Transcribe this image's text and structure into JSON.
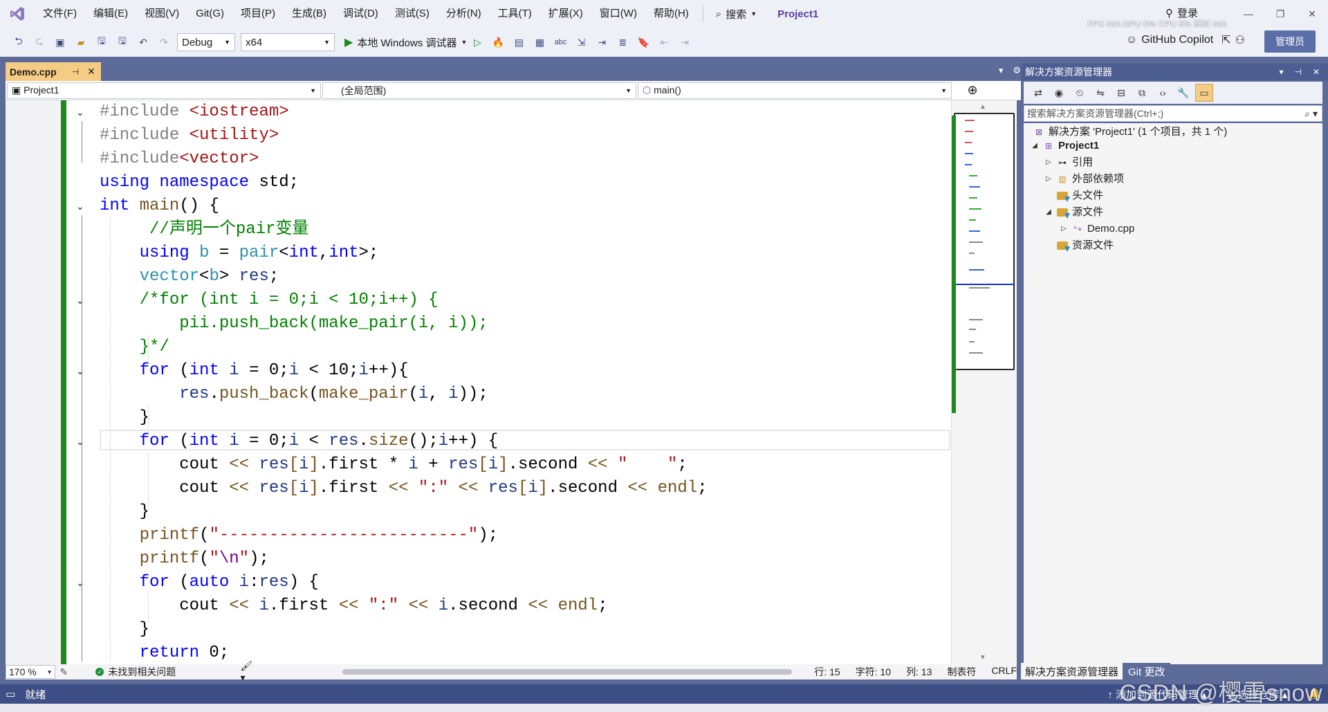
{
  "titlebar": {
    "menu": [
      "文件(F)",
      "编辑(E)",
      "视图(V)",
      "Git(G)",
      "项目(P)",
      "生成(B)",
      "调试(D)",
      "测试(S)",
      "分析(N)",
      "工具(T)",
      "扩展(X)",
      "窗口(W)",
      "帮助(H)"
    ],
    "search_label": "搜索",
    "project_title": "Project1",
    "login_label": "登录",
    "perf_text": "FPS N/A GPU 0% CPU 5% 延时 N/A"
  },
  "toolbar": {
    "config": "Debug",
    "platform": "x64",
    "run_label": "本地 Windows 调试器",
    "copilot_label": "GitHub Copilot",
    "admin_label": "管理员"
  },
  "document_tab": {
    "name": "Demo.cpp",
    "pin": "⊣",
    "close": "✕"
  },
  "navbar": {
    "project": "Project1",
    "scope": "(全局范围)",
    "member": "main()"
  },
  "editor": {
    "lines": [
      "#include <iostream>",
      "#include <utility>",
      "#include<vector>",
      "using namespace std;",
      "int main() {",
      "     //声明一个pair变量",
      "    using b = pair<int,int>;",
      "    vector<b> res;",
      "    /*for (int i = 0;i < 10;i++) {",
      "        pii.push_back(make_pair(i, i));",
      "    }*/",
      "    for (int i = 0;i < 10;i++){",
      "        res.push_back(make_pair(i, i));",
      "    }",
      "    for (int i = 0;i < res.size();i++) {",
      "        cout << res[i].first * i + res[i].second << \"    \";",
      "        cout << res[i].first << \":\" << res[i].second << endl;",
      "    }",
      "    printf(\"-------------------------\");",
      "    printf(\"\\n\");",
      "    for (auto i:res) {",
      "        cout << i.first << \":\" << i.second << endl;",
      "    }",
      "    return 0;"
    ]
  },
  "editor_status": {
    "zoom": "170 %",
    "issues": "未找到相关问题",
    "row": "行: 15",
    "char": "字符: 10",
    "col": "列: 13",
    "tab": "制表符",
    "eol": "CRLF"
  },
  "solution_explorer": {
    "title": "解决方案资源管理器",
    "search_placeholder": "搜索解决方案资源管理器(Ctrl+;)",
    "tree": {
      "solution": "解决方案 'Project1' (1 个项目，共 1 个)",
      "project": "Project1",
      "references": "引用",
      "external_deps": "外部依赖项",
      "headers": "头文件",
      "sources": "源文件",
      "demo_cpp": "Demo.cpp",
      "resources": "资源文件"
    },
    "bottom_tabs": [
      "解决方案资源管理器",
      "Git 更改"
    ]
  },
  "statusbar": {
    "ready": "就绪",
    "add_source": "添加到源代码管理",
    "select_repo": "选择仓库"
  },
  "watermark": "CSDN @樱雪snow",
  "colors": {
    "accent_tab": "#f5cc84",
    "frame": "#5d6b99",
    "status": "#3e4e86",
    "change_bar": "#1e8a1e"
  }
}
